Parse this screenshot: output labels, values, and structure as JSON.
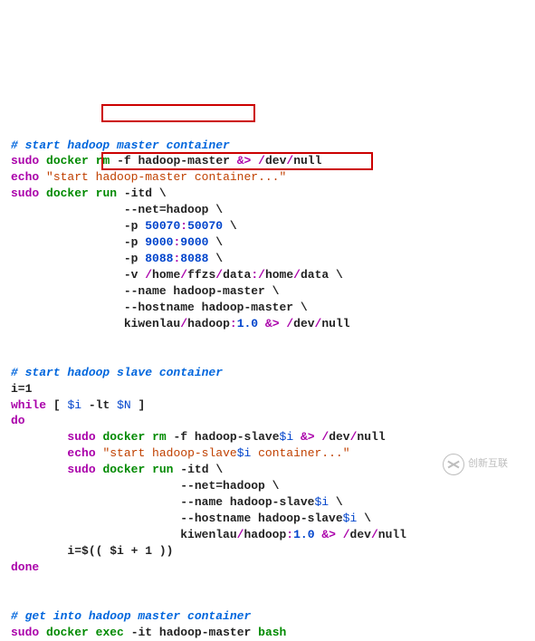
{
  "comments": {
    "master_start": "# start hadoop master container",
    "slave_start": "# start hadoop slave container",
    "get_into": "# get into hadoop master container"
  },
  "cmds": {
    "sudo": "sudo",
    "echo": "echo",
    "while": "while",
    "do": "do",
    "done": "done",
    "docker": "docker",
    "rm": "rm",
    "run": "run",
    "exec": "exec"
  },
  "master": {
    "rm_flags": "-f",
    "rm_target": "hadoop-master",
    "rm_redirect_amp": "&>",
    "rm_redirect_path": "/dev/null",
    "echo_str": "\"start hadoop-master container...\"",
    "run_flags": "-itd",
    "net": "--net=hadoop",
    "p1_a": "50070",
    "p1_b": "50070",
    "p2_a": "9000",
    "p2_b": "9000",
    "p3_a": "8088",
    "p3_b": "8088",
    "vol_a": "home",
    "vol_b": "ffzs",
    "vol_c": "data",
    "vol_d": "home",
    "vol_e": "data",
    "name": "--name hadoop-master",
    "hostname": "--hostname hadoop-master",
    "image_user": "kiwenlau",
    "image_repo": "hadoop",
    "image_tag": "1.0"
  },
  "slave": {
    "i_init": "i=1",
    "while_cond_var": "$i",
    "while_cond_op": "-lt",
    "while_cond_n": "$N",
    "rm_flags": "-f",
    "rm_target_prefix": "hadoop-slave",
    "rm_target_var": "$i",
    "rm_redirect_amp": "&>",
    "rm_redirect_path": "/dev/null",
    "echo_prefix": "\"start hadoop-slave",
    "echo_var": "$i",
    "echo_suffix": " container...\"",
    "run_flags": "-itd",
    "net": "--net=hadoop",
    "name_prefix": "--name hadoop-slave",
    "name_var": "$i",
    "hostname_prefix": "--hostname hadoop-slave",
    "hostname_var": "$i",
    "image_user": "kiwenlau",
    "image_repo": "hadoop",
    "image_tag": "1.0",
    "incr": "i=$(( $i + 1 ))"
  },
  "exec": {
    "flags": "-it",
    "target": "hadoop-master",
    "shell": "bash"
  },
  "watermark": "创新互联"
}
